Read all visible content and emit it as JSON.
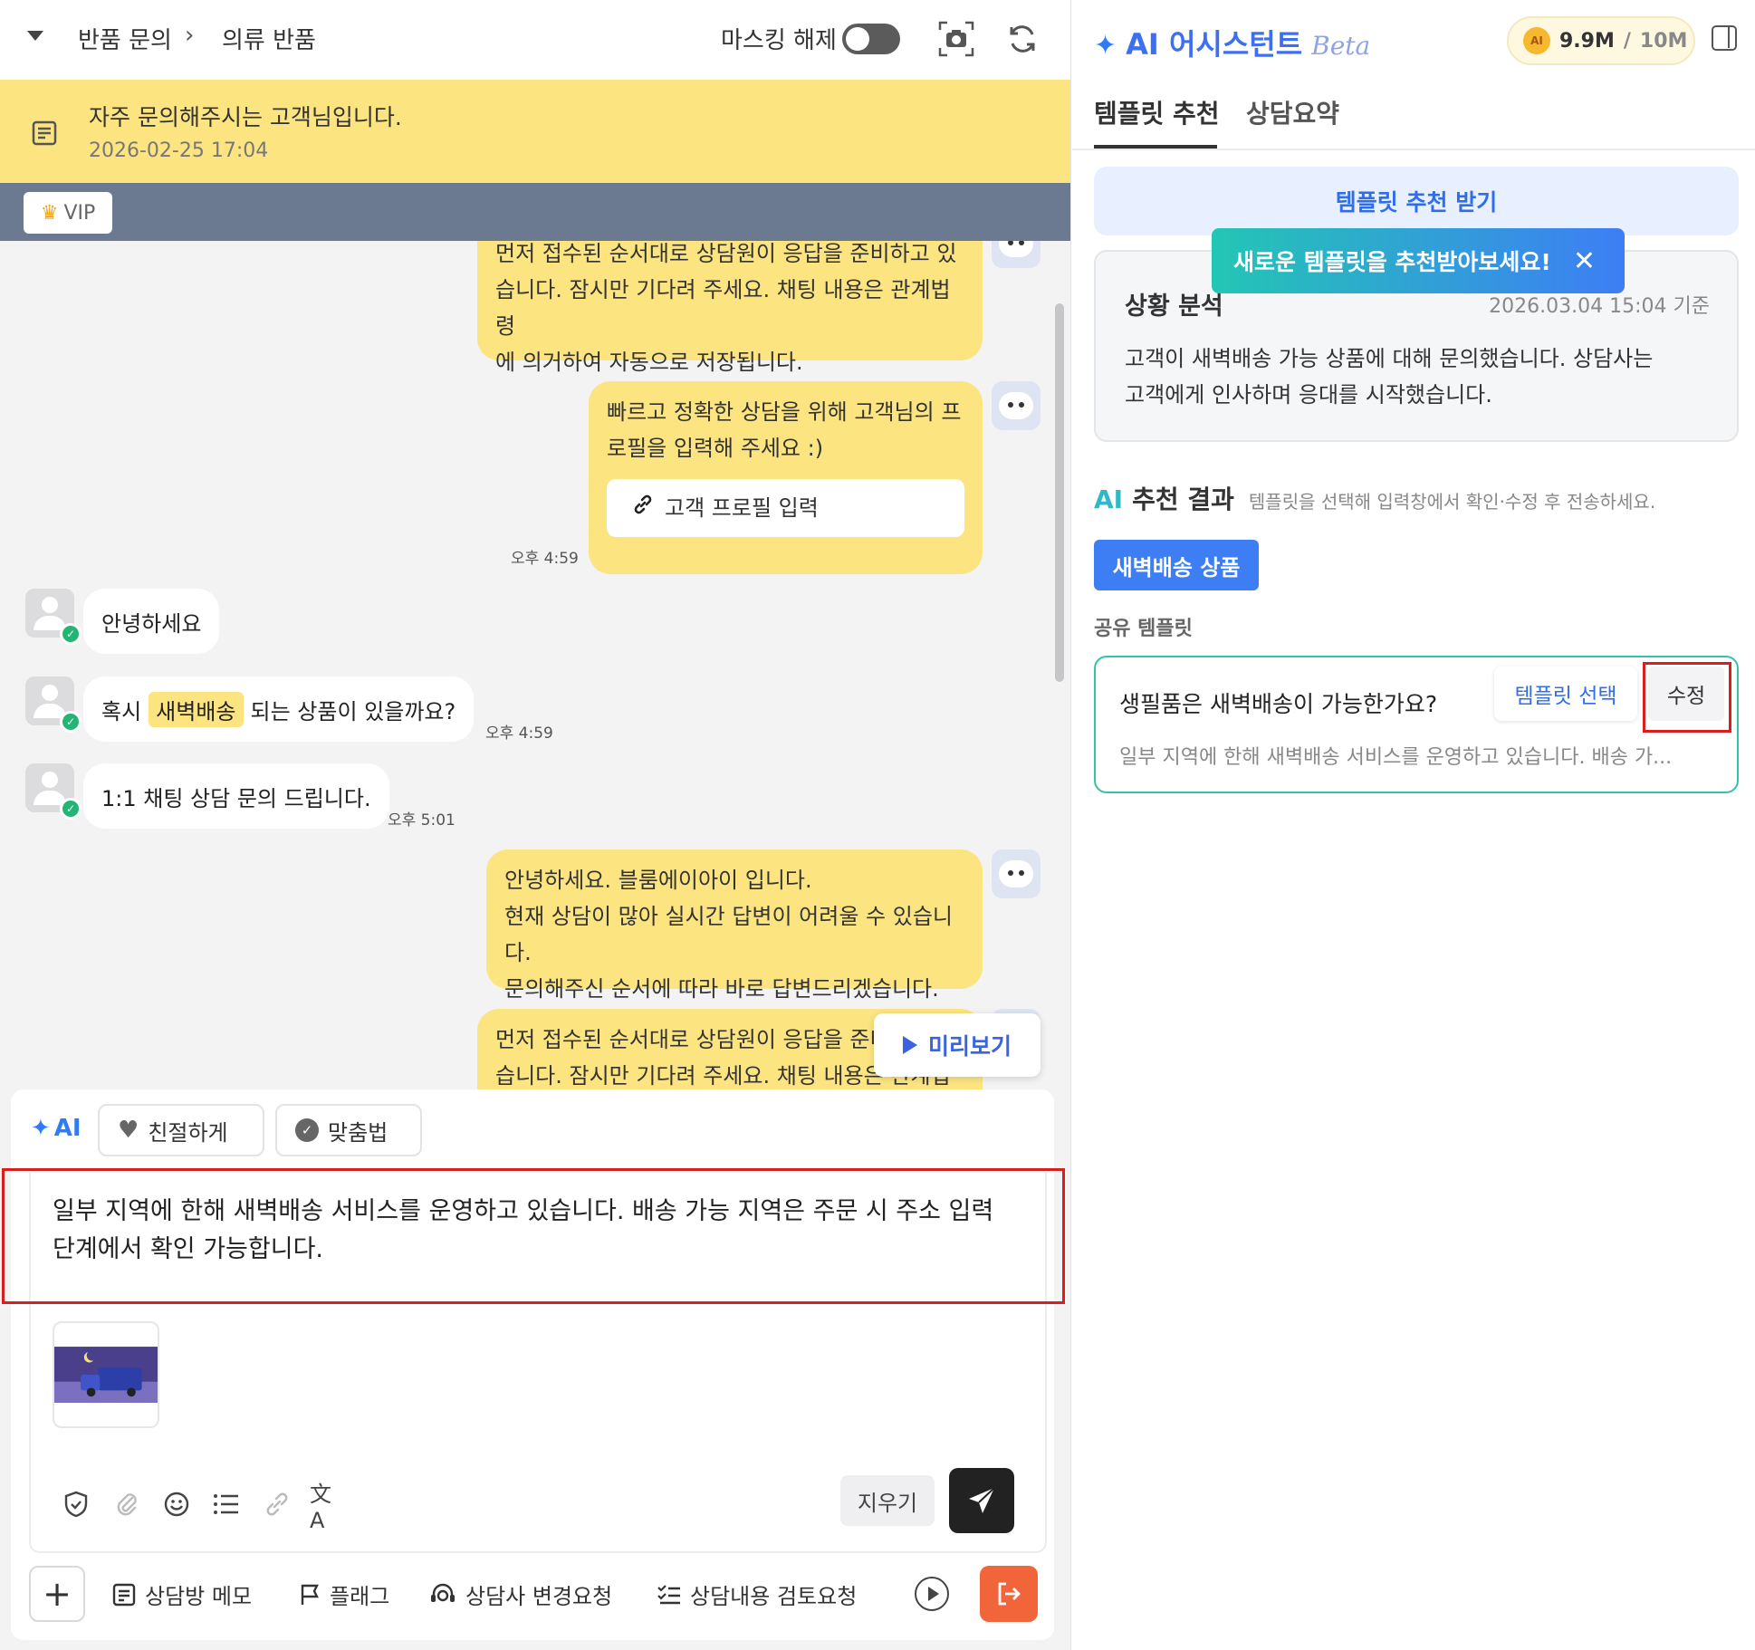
{
  "header": {
    "breadcrumb_1": "반품 문의",
    "breadcrumb_2": "의류 반품",
    "masking_label": "마스킹 해제"
  },
  "notice": {
    "text": "자주 문의해주시는 고객님입니다.",
    "date": "2026-02-25 17:04"
  },
  "vip_label": "VIP",
  "messages": {
    "m1_line1": "먼저 접수된 순서대로 상담원이 응답을 준비하고 있",
    "m1_line2": "습니다. 잠시만 기다려 주세요. 채팅 내용은 관계법령",
    "m1_line3": "에 의거하여 자동으로 저장됩니다.",
    "m2_line1": "빠르고 정확한 상담을 위해 고객님의 프",
    "m2_line2": "로필을 입력해 주세요 :)",
    "m2_button": "고객 프로필 입력",
    "m2_time": "오후 4:59",
    "c1_text": "안녕하세요",
    "c2_before": "혹시",
    "c2_highlight": "새벽배송",
    "c2_after": "되는 상품이 있을까요?",
    "c2_time": "오후 4:59",
    "c3_text": "1:1 채팅 상담 문의 드립니다.",
    "c3_time": "오후 5:01",
    "m3_line1": "안녕하세요. 블룸에이아이 입니다.",
    "m3_line2": "현재 상담이 많아 실시간 답변이 어려울 수 있습니다.",
    "m3_line3": "문의해주신 순서에 따라 바로 답변드리겠습니다.",
    "m4_line1": "먼저 접수된 순서대로 상담원이 응답을 준비",
    "m4_line2": "습니다. 잠시만 기다려 주세요. 채팅 내용은 관계법령",
    "preview_label": "미리보기"
  },
  "composer": {
    "ai_label": "AI",
    "chip_kind": "친절하게",
    "chip_spell": "맞춤법",
    "text_line1": "일부 지역에 한해 새벽배송 서비스를 운영하고 있습니다. 배송 가능 지역은 주문 시 주소 입력",
    "text_line2": "단계에서 확인 가능합니다.",
    "clear_label": "지우기"
  },
  "bottom_bar": {
    "memo": "상담방 메모",
    "flag": "플래그",
    "change_agent": "상담사 변경요청",
    "review": "상담내용 검토요청"
  },
  "assistant": {
    "title": "AI 어시스턴트",
    "beta": "Beta",
    "usage_used": "9.9M",
    "usage_sep": "/",
    "usage_total": "10M",
    "tab_template": "템플릿 추천",
    "tab_summary": "상담요약",
    "get_template_button": "템플릿 추천 받기",
    "tooltip": "새로운 템플릿을 추천받아보세요!",
    "analysis_title": "상황 분석",
    "analysis_time": "2026.03.04 15:04 기준",
    "analysis_line1": "고객이 새벽배송 가능 상품에 대해 문의했습니다. 상담사는",
    "analysis_line2": "고객에게 인사하며 응대를 시작했습니다.",
    "result_title_ai": "AI",
    "result_title_rest": "추천 결과",
    "result_hint": "템플릿을 선택해 입력창에서 확인·수정 후 전송하세요.",
    "keyword_tag": "새벽배송 상품",
    "shared_label": "공유 템플릿",
    "template_question": "생필품은 새벽배송이 가능한가요?",
    "template_select": "템플릿 선택",
    "template_edit": "수정",
    "template_preview": "일부 지역에 한해 새벽배송 서비스를 운영하고 있습니다. 배송 가..."
  },
  "colors": {
    "accent_blue": "#3d7ef5",
    "teal": "#25c4b0",
    "yellow": "#fce581",
    "red_highlight": "#d81e1e",
    "orange": "#f2643a"
  }
}
